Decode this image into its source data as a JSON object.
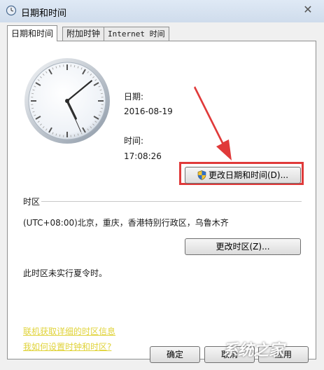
{
  "window": {
    "title": "日期和时间",
    "close_glyph": "✕"
  },
  "tabs": [
    {
      "label": "日期和时间",
      "active": true
    },
    {
      "label": "附加时钟",
      "active": false
    },
    {
      "label": "Internet 时间",
      "active": false
    }
  ],
  "clock": {
    "hour": 17,
    "minute": 8,
    "second": 26
  },
  "datetime": {
    "date_label": "日期:",
    "date_value": "2016-08-19",
    "time_label": "时间:",
    "time_value": "17:08:26",
    "change_button": "更改日期和时间(D)..."
  },
  "timezone": {
    "section_label": "时区",
    "value": "(UTC+08:00)北京，重庆，香港特别行政区，乌鲁木齐",
    "change_button": "更改时区(Z)...",
    "dst_note": "此时区未实行夏令时。"
  },
  "links": [
    "联机获取详细的时区信息",
    "我如何设置时钟和时区?"
  ],
  "footer": {
    "ok": "确定",
    "cancel": "取消",
    "apply": "应用"
  },
  "annotation": {
    "color": "#e03a3a"
  },
  "watermark": "系统之家"
}
